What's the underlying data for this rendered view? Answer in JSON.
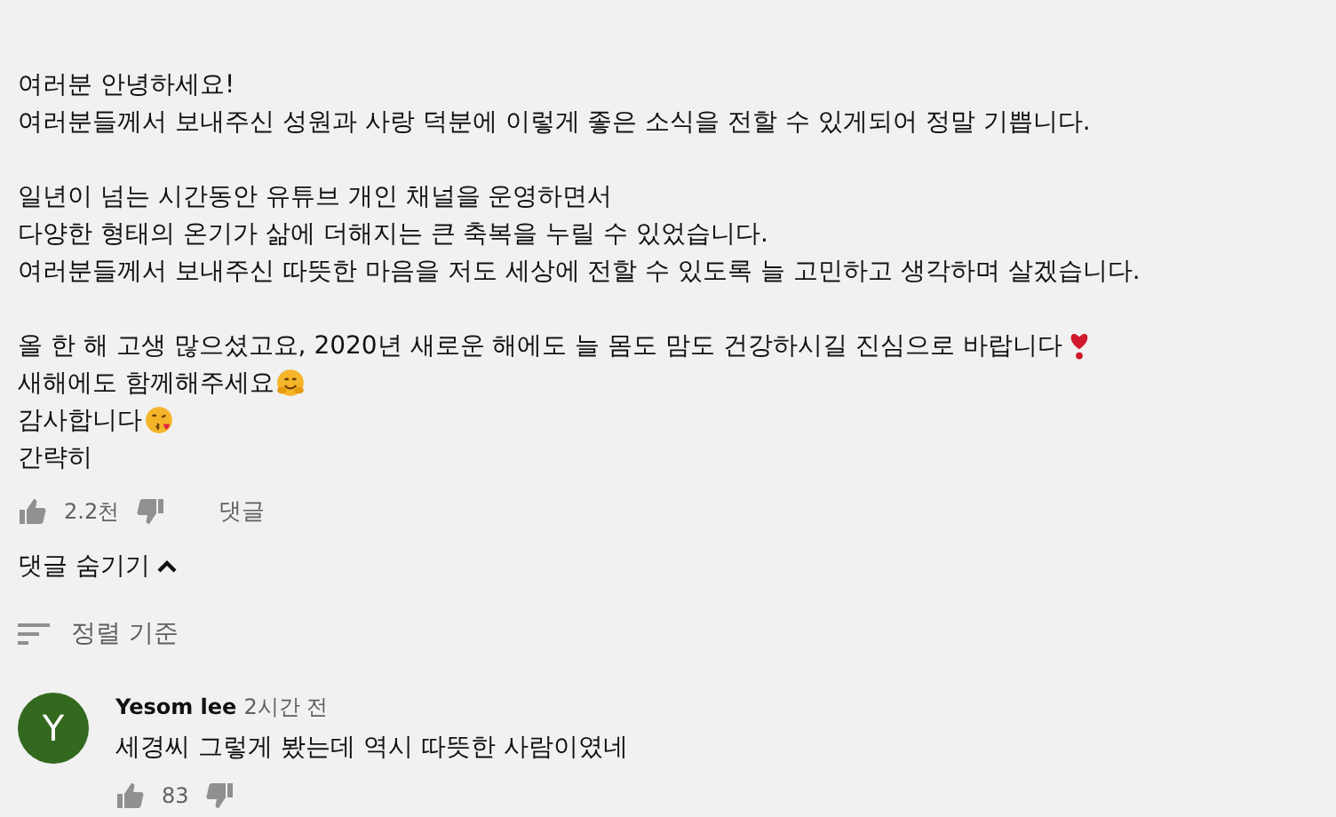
{
  "post": {
    "paragraphs": [
      {
        "lines": [
          {
            "text": "여러분 안녕하세요!"
          },
          {
            "text": "여러분들께서 보내주신 성원과 사랑 덕분에 이렇게 좋은 소식을 전할 수 있게되어 정말 기쁩니다."
          }
        ]
      },
      {
        "lines": [
          {
            "text": "일년이 넘는 시간동안 유튜브 개인 채널을 운영하면서"
          },
          {
            "text": "다양한 형태의 온기가 삶에 더해지는 큰 축복을 누릴 수 있었습니다."
          },
          {
            "text": "여러분들께서 보내주신 따뜻한 마음을 저도 세상에 전할 수 있도록 늘 고민하고 생각하며 살겠습니다."
          }
        ]
      },
      {
        "lines": [
          {
            "text": "올 한 해 고생 많으셨고요, 2020년 새로운 해에도 늘 몸도 맘도 건강하시길 진심으로 바랍니다",
            "kind": "heart"
          },
          {
            "text": "새해에도 함께해주세요",
            "kind": "hug"
          },
          {
            "text": "감사합니다",
            "kind": "kiss"
          }
        ]
      }
    ],
    "collapse_link": "간략히",
    "likes": "2.2천",
    "reply_label": "댓글",
    "hide_replies": "댓글 숨기기",
    "sort_label": "정렬 기준"
  },
  "comments": [
    {
      "avatar_letter": "Y",
      "author": "Yesom lee",
      "time": "2시간 전",
      "text": "세경씨 그렇게 봤는데 역시 따뜻한 사람이였네",
      "likes": "83"
    }
  ]
}
